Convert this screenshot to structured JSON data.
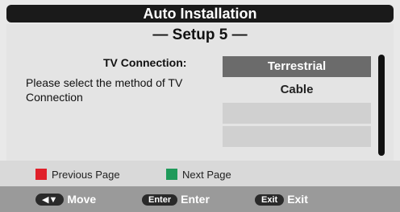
{
  "window": {
    "title": "Auto Installation"
  },
  "setup": {
    "title": "— Setup 5 —"
  },
  "connection": {
    "label": "TV Connection:",
    "description": "Please select the method of TV Connection"
  },
  "options": [
    {
      "label": "Terrestrial"
    },
    {
      "label": "Cable"
    },
    {
      "label": ""
    },
    {
      "label": ""
    }
  ],
  "legend": {
    "previous": {
      "label": "Previous Page",
      "color": "#e0202a"
    },
    "next": {
      "label": "Next Page",
      "color": "#1f9a5a"
    }
  },
  "footer": {
    "move": {
      "key": "◀▼",
      "label": "Move"
    },
    "enter": {
      "key": "Enter",
      "label": "Enter"
    },
    "exit": {
      "key": "Exit",
      "label": "Exit"
    }
  },
  "colors": {
    "title_bar": "#1a1a1a",
    "selected": "#6b6b6b",
    "footer": "#9a9a9a"
  }
}
